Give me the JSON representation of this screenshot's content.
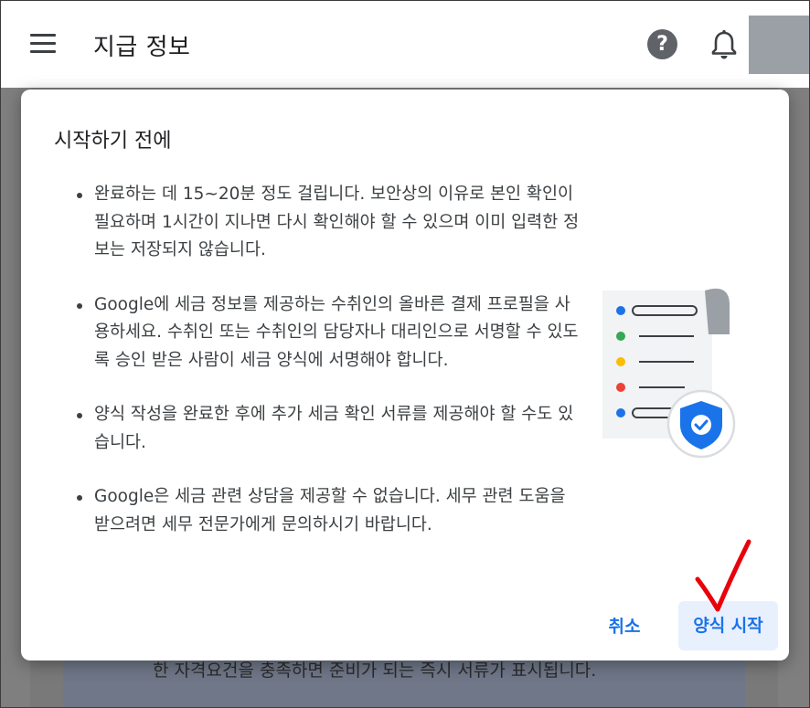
{
  "app_bar": {
    "title": "지급 정보",
    "help_icon": "help-icon",
    "bell_icon": "bell-icon",
    "menu_icon": "menu-icon"
  },
  "background": {
    "text": "한 자격요건을 충족하면 준비가 되는 즉시 서류가 표시됩니다."
  },
  "dialog": {
    "title": "시작하기 전에",
    "bullets": [
      "완료하는 데 15~20분 정도 걸립니다. 보안상의 이유로 본인 확인이 필요하며 1시간이 지나면 다시 확인해야 할 수 있으며 이미 입력한 정보는 저장되지 않습니다.",
      "Google에 세금 정보를 제공하는 수취인의 올바른 결제 프로필을 사용하세요. 수취인 또는 수취인의 담당자나 대리인으로 서명할 수 있도록 승인 받은 사람이 세금 양식에 서명해야 합니다.",
      "양식 작성을 완료한 후에 추가 세금 확인 서류를 제공해야 할 수도 있습니다.",
      "Google은 세금 관련 상담을 제공할 수 없습니다. 세무 관련 도움을 받으려면 세무 전문가에게 문의하시기 바랍니다."
    ],
    "cancel_label": "취소",
    "start_label": "양식 시작",
    "illustration_icon": "document-shield-check-icon"
  },
  "colors": {
    "accent": "#1a73e8",
    "button_bg": "#e8f0fe",
    "annotation_red": "#e8000b",
    "dot_blue": "#1a73e8",
    "dot_green": "#34a853",
    "dot_yellow": "#fbbc04",
    "dot_red": "#ea4335"
  }
}
